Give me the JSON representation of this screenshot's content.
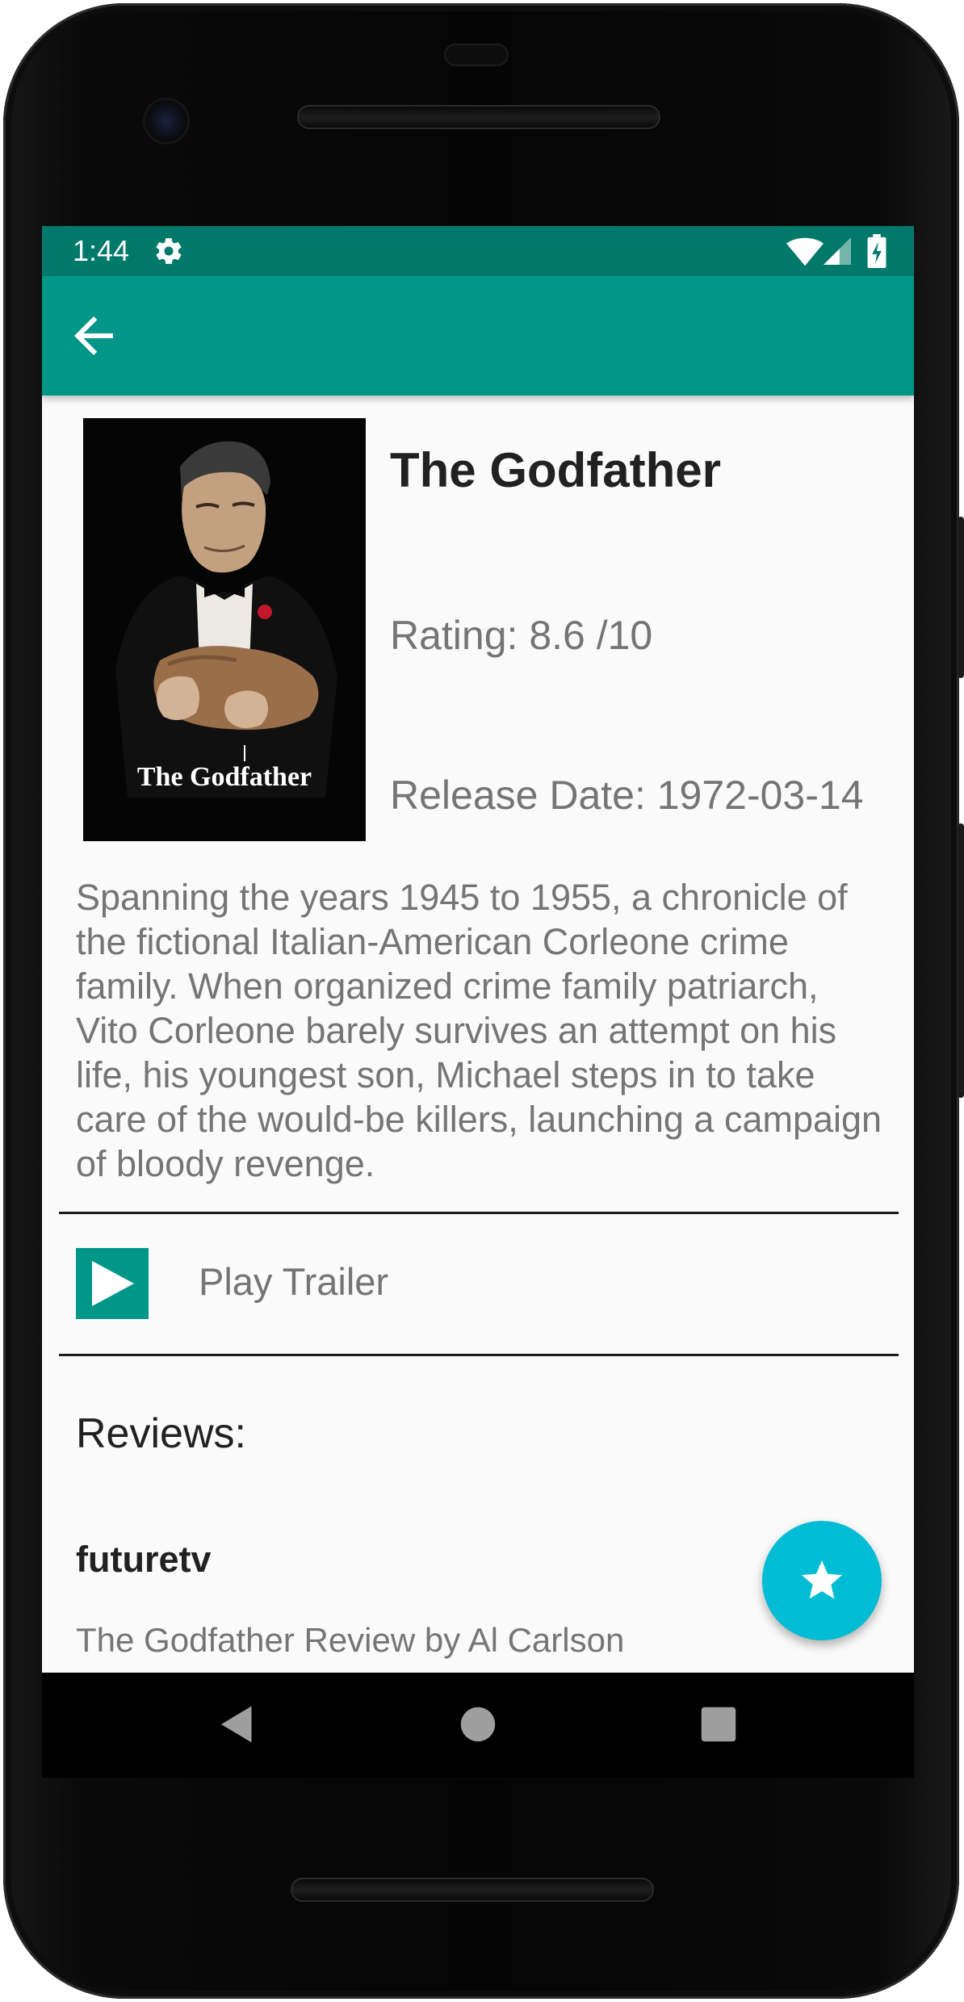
{
  "status_bar": {
    "time": "1:44",
    "background": "#00796b"
  },
  "app_bar": {
    "background": "#009688",
    "back_icon": "arrow-back-icon"
  },
  "movie": {
    "title": "The Godfather",
    "rating": "Rating: 8.6 /10",
    "release_date": "Release Date: 1972-03-14",
    "overview": "Spanning the years 1945 to 1955, a chronicle of the fictional Italian-American Corleone crime family. When organized crime family patriarch, Vito Corleone barely survives an attempt on his life, his youngest son, Michael steps in to take care of the would-be killers, launching a campaign of bloody revenge.",
    "poster_logo_text": "The Godfather"
  },
  "trailer": {
    "label": "Play Trailer",
    "icon": "play-icon",
    "icon_color": "#009688"
  },
  "reviews": {
    "heading": "Reviews:",
    "items": [
      {
        "author": "futuretv",
        "content": "The Godfather Review by Al Carlson"
      }
    ]
  },
  "fab": {
    "icon": "star-icon",
    "color": "#00bcd4"
  },
  "nav_bar": {
    "back_icon": "triangle-back-icon",
    "home_icon": "circle-home-icon",
    "recent_icon": "square-recents-icon"
  }
}
